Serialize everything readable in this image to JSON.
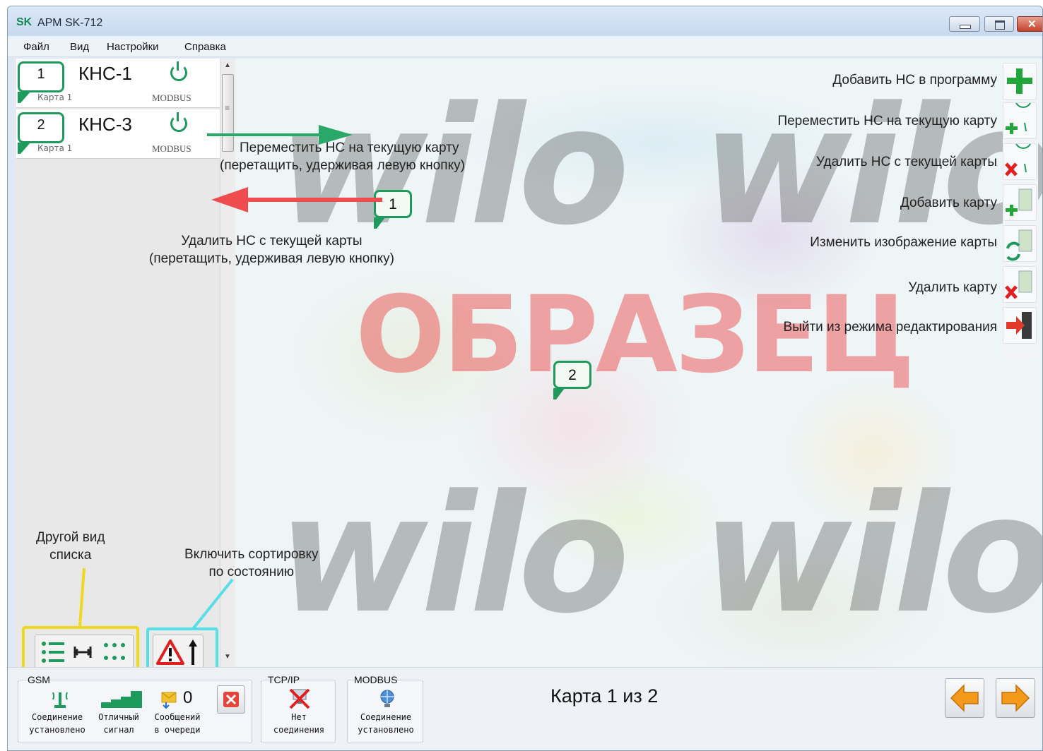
{
  "window": {
    "logo": "SK",
    "title": "АРМ SK-712"
  },
  "menu": [
    {
      "label": "Файл"
    },
    {
      "label": "Вид"
    },
    {
      "label": "Настройки"
    },
    {
      "label": "Справка"
    }
  ],
  "stations": [
    {
      "number": "1",
      "name": "КНС-1",
      "map": "Карта 1",
      "protocol": "MODBUS"
    },
    {
      "number": "2",
      "name": "КНС-3",
      "map": "Карта 1",
      "protocol": "MODBUS"
    }
  ],
  "map": {
    "watermark": "wilo",
    "stamp": "ОБРАЗЕЦ",
    "pins": [
      {
        "number": "1"
      },
      {
        "number": "2"
      }
    ],
    "annotations": {
      "move_line1": "Переместить НС на текущую карту",
      "move_line2": "(перетащить, удерживая левую кнопку)",
      "delete_line1": "Удалить НС с текущей карты",
      "delete_line2": "(перетащить, удерживая левую кнопку)"
    }
  },
  "tools": [
    {
      "label": "Добавить НС в программу",
      "icon": "plus-icon"
    },
    {
      "label": "Переместить НС на текущую карту",
      "icon": "pin-plus-icon"
    },
    {
      "label": "Удалить НС с текущей карты",
      "icon": "pin-remove-icon"
    },
    {
      "label": "Добавить карту",
      "icon": "map-add-icon"
    },
    {
      "label": "Изменить изображение карты",
      "icon": "map-edit-icon"
    },
    {
      "label": "Удалить карту",
      "icon": "map-delete-icon"
    },
    {
      "label": "Выйти из режима редактирования",
      "icon": "exit-icon"
    }
  ],
  "callouts": {
    "view_line1": "Другой вид",
    "view_line2": "списка",
    "sort_line1": "Включить сортировку",
    "sort_line2": "по состоянию"
  },
  "status": {
    "gsm": {
      "title": "GSM",
      "connection_line1": "Соединение",
      "connection_line2": "установлено",
      "signal_line1": "Отличный",
      "signal_line2": "сигнал",
      "queue_count": "0",
      "queue_line1": "Сообщений",
      "queue_line2": "в очереди"
    },
    "tcp": {
      "title": "TCP/IP",
      "line1": "Нет",
      "line2": "соединения"
    },
    "modbus": {
      "title": "MODBUS",
      "line1": "Соединение",
      "line2": "установлено"
    }
  },
  "pager": {
    "text": "Карта 1 из 2"
  },
  "colors": {
    "accent_green": "#1e9a5c",
    "stamp_red": "#eb3c3c",
    "callout_yellow": "#f0d820",
    "callout_cyan": "#57dfe8",
    "nav_orange": "#f39a1a"
  }
}
